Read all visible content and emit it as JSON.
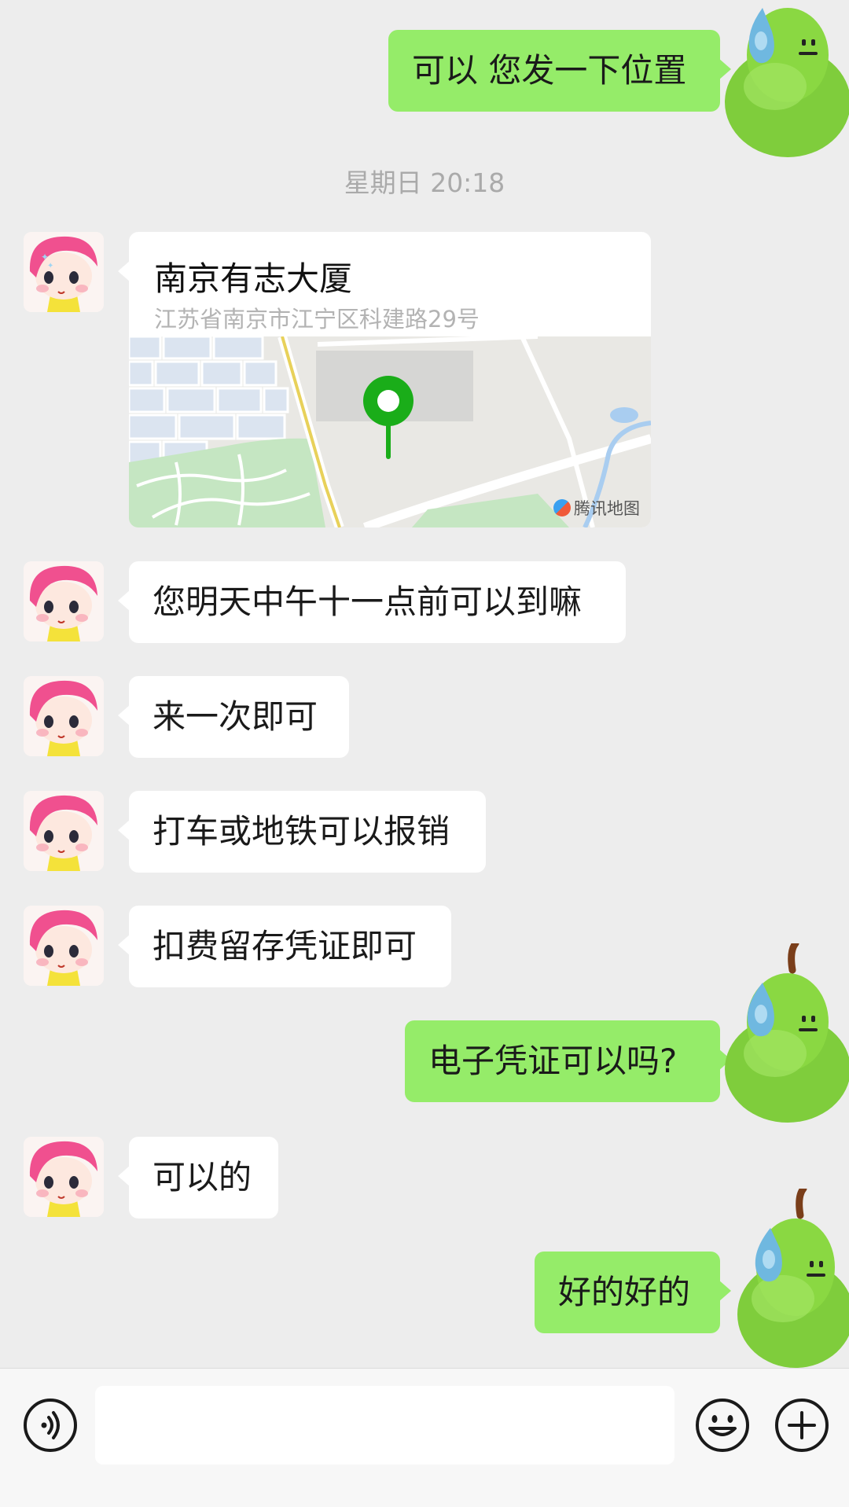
{
  "timestamp": "星期日 20:18",
  "location": {
    "title": "南京有志大厦",
    "address": "江苏省南京市江宁区科建路29号",
    "map_credit": "腾讯地图"
  },
  "messages": [
    {
      "side": "out",
      "text": "可以 您发一下位置"
    },
    {
      "side": "in",
      "text": "您明天中午十一点前可以到嘛"
    },
    {
      "side": "in",
      "text": "来一次即可"
    },
    {
      "side": "in",
      "text": "打车或地铁可以报销"
    },
    {
      "side": "in",
      "text": "扣费留存凭证即可"
    },
    {
      "side": "out",
      "text": "电子凭证可以吗?"
    },
    {
      "side": "in",
      "text": "可以的"
    },
    {
      "side": "out",
      "text": "好的好的"
    }
  ],
  "input_bar": {
    "voice_icon": "voice-icon",
    "emoji_icon": "emoji-icon",
    "plus_icon": "plus-icon",
    "input_value": ""
  },
  "colors": {
    "outgoing_bubble": "#95ec69",
    "incoming_bubble": "#ffffff",
    "background": "#ededed"
  }
}
